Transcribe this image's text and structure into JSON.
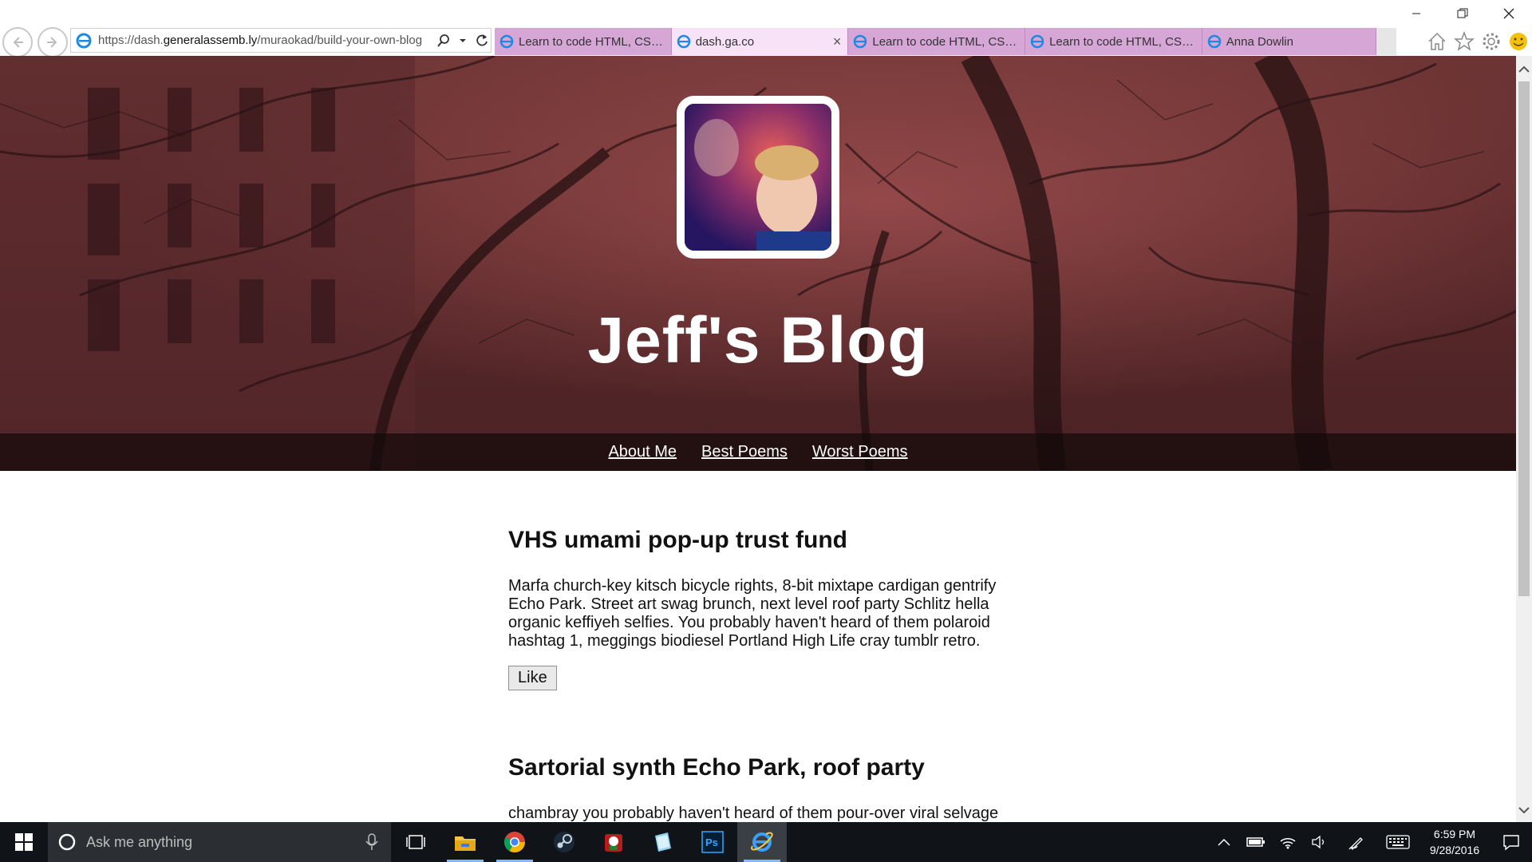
{
  "browser": {
    "address": {
      "prefix": "https://dash.",
      "domain": "generalassemb.ly",
      "path": "/muraokad/build-your-own-blog"
    },
    "tabs": [
      {
        "label": "Learn to code HTML, CSS, a...",
        "active": false
      },
      {
        "label": "dash.ga.co",
        "active": true,
        "close": "×"
      },
      {
        "label": "Learn to code HTML, CSS, a...",
        "active": false
      },
      {
        "label": "Learn to code HTML, CSS, a...",
        "active": false
      },
      {
        "label": "Anna Dowlin",
        "active": false
      }
    ],
    "accent": "#d6a6d6"
  },
  "page": {
    "blog_title": "Jeff's Blog",
    "nav": [
      "About Me",
      "Best Poems",
      "Worst Poems"
    ],
    "posts": [
      {
        "title": "VHS umami pop-up trust fund",
        "body": "Marfa church-key kitsch bicycle rights, 8-bit mixtape cardigan gentrify Echo Park. Street art swag brunch, next level roof party Schlitz hella organic keffiyeh selfies. You probably haven't heard of them polaroid hashtag 1, meggings biodiesel Portland High Life cray tumblr retro.",
        "button": "Like"
      },
      {
        "title": "Sartorial synth Echo Park, roof party",
        "body": "chambray you probably haven't heard of them pour-over viral selvage"
      }
    ]
  },
  "taskbar": {
    "search_placeholder": "Ask me anything",
    "apps": [
      "task-view-icon",
      "file-explorer-icon",
      "chrome-icon",
      "steam-icon",
      "game-icon",
      "notepad-icon",
      "photoshop-icon",
      "internet-explorer-icon"
    ],
    "photoshop_label": "Ps",
    "time": "6:59 PM",
    "date": "9/28/2016"
  }
}
